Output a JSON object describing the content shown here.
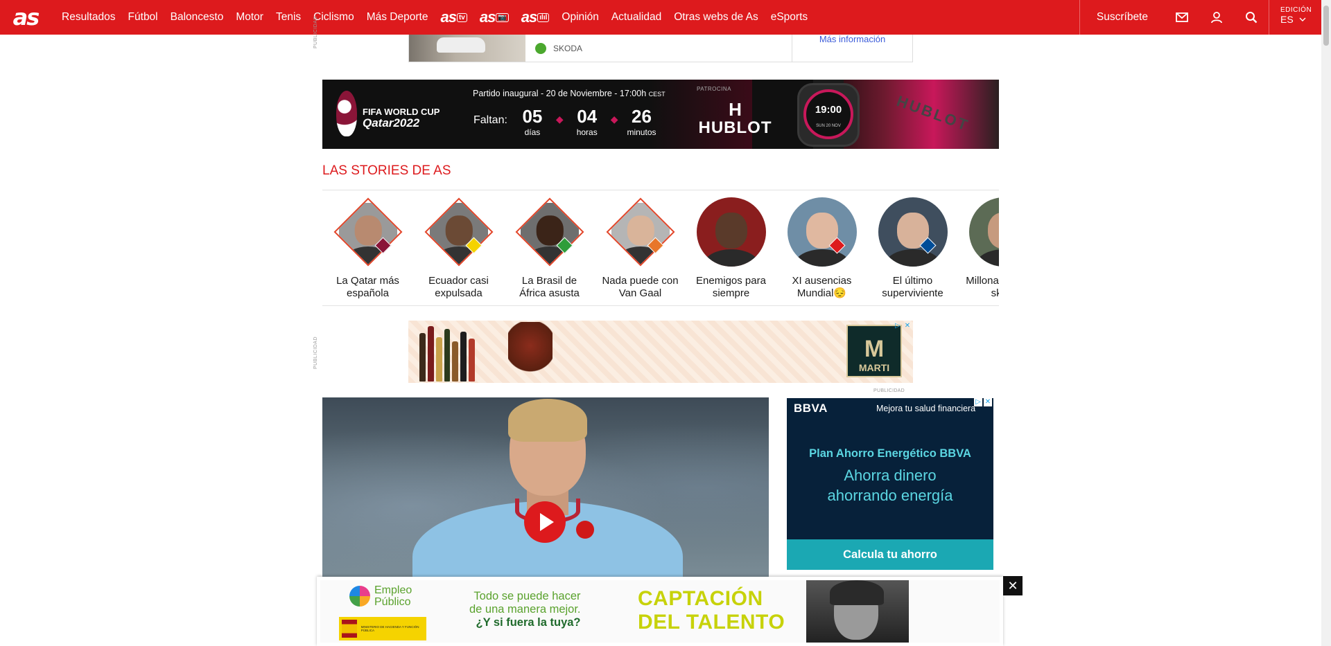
{
  "nav": {
    "logo": "as",
    "items": [
      "Resultados",
      "Fútbol",
      "Baloncesto",
      "Motor",
      "Tenis",
      "Ciclismo",
      "Más Deporte"
    ],
    "brands": [
      {
        "text": "as",
        "badge": "tv"
      },
      {
        "text": "as",
        "badge": "📷"
      },
      {
        "text": "as",
        "badge": "ılıl"
      }
    ],
    "items2": [
      "Opinión",
      "Actualidad",
      "Otras webs de As",
      "eSports"
    ],
    "subscribe": "Suscríbete",
    "edition_label": "EDICIÓN",
    "edition_value": "ES",
    "icons": [
      "mail-icon",
      "user-icon",
      "search-icon",
      "chevron-down-icon"
    ]
  },
  "top_ad": {
    "brand": "SKODA",
    "link_text": "Más información",
    "side_label": "PUBLICIDAD"
  },
  "wc_banner": {
    "logo_line1": "FIFA WORLD CUP",
    "logo_line2": "Qatar2022",
    "subtitle": "Partido inaugural - 20 de Noviembre - 17:00h",
    "subtitle_tz": "CEST",
    "faltan": "Faltan:",
    "days": "05",
    "days_label": "días",
    "hours": "04",
    "hours_label": "horas",
    "minutes": "26",
    "minutes_label": "minutos",
    "sponsor_label": "PATROCINA",
    "sponsor_mark": "H",
    "sponsor_name": "HUBLOT",
    "watch_time": "19:00",
    "watch_date": "SUN 20 NOV",
    "strap_text": "HUBLOT",
    "accent_color": "#c8185a"
  },
  "stories": {
    "title": "LAS STORIES DE AS",
    "items": [
      {
        "label": "La Qatar más española",
        "shape": "diamond",
        "skin": "#b88a70",
        "bg": "#9a9a9a",
        "flag": "#8a1538"
      },
      {
        "label": "Ecuador casi expulsada",
        "shape": "diamond",
        "skin": "#6b4a35",
        "bg": "#7a7a7a",
        "flag": "#f5d300"
      },
      {
        "label": "La Brasil de África asusta",
        "shape": "diamond",
        "skin": "#3b2418",
        "bg": "#6e6e6e",
        "flag": "#2e9d3a"
      },
      {
        "label": "Nada puede con Van Gaal",
        "shape": "diamond",
        "skin": "#d9b49a",
        "bg": "#b5b5b5",
        "flag": "#e8762a"
      },
      {
        "label": "Enemigos para siempre",
        "shape": "circle",
        "skin": "#5a3a2a",
        "bg": "#8a1e1e",
        "flag": ""
      },
      {
        "label": "XI ausencias Mundial😔",
        "shape": "circle",
        "skin": "#e0b8a0",
        "bg": "#6f8ea6",
        "flag": "#dd1a1d"
      },
      {
        "label": "El último superviviente",
        "shape": "circle",
        "skin": "#d8b29a",
        "bg": "#3f4e5e",
        "flag": "#004d98"
      },
      {
        "label": "Millonarios en el skate",
        "shape": "circle",
        "skin": "#c69a7e",
        "bg": "#5c6b55",
        "flag": ""
      }
    ]
  },
  "mid_ad": {
    "side_label": "PUBLICIDAD",
    "brand": "MARTI",
    "below_label": "PUBLICIDAD"
  },
  "video": {
    "play_label": "play"
  },
  "bbva_ad": {
    "logo": "BBVA",
    "tagline": "Mejora tu salud financiera",
    "plan": "Plan Ahorro Energético BBVA",
    "headline_1": "Ahorra dinero",
    "headline_2": "ahorrando energía",
    "cta": "Calcula tu ahorro"
  },
  "sticky_ad": {
    "logo_line1": "Empleo",
    "logo_line2": "Público",
    "gov_text": "MINISTERIO DE HACIENDA Y FUNCIÓN PÚBLICA",
    "copy_1": "Todo se puede hacer",
    "copy_2": "de una manera mejor.",
    "copy_3": "¿Y si fuera la tuya?",
    "headline_1": "CAPTACIÓN",
    "headline_2": "DEL TALENTO",
    "close": "✕"
  }
}
